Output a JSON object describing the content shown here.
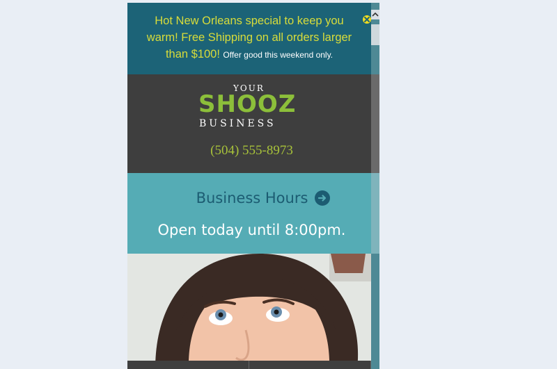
{
  "promo": {
    "main_text": "Hot New Orleans special to keep you warm! Free Shipping on all orders larger than $100!",
    "small_text": "Offer good this weekend only."
  },
  "logo": {
    "your": "YOUR",
    "shooz": "SHOOZ",
    "business": "BUSINESS"
  },
  "header": {
    "phone": "(504) 555-8973"
  },
  "hours": {
    "label": "Business Hours",
    "status": "Open today until 8:00pm."
  },
  "colors": {
    "promo_bg": "#1c6377",
    "promo_text": "#d8dc3a",
    "header_bg": "#3e3e3e",
    "logo_green": "#8cbf3a",
    "hours_bg": "#55acb5",
    "hours_link": "#1c5c72"
  },
  "icons": {
    "close": "close-circle-icon",
    "arrow": "arrow-right-circle-icon",
    "scroll_up": "chevron-up-icon"
  }
}
